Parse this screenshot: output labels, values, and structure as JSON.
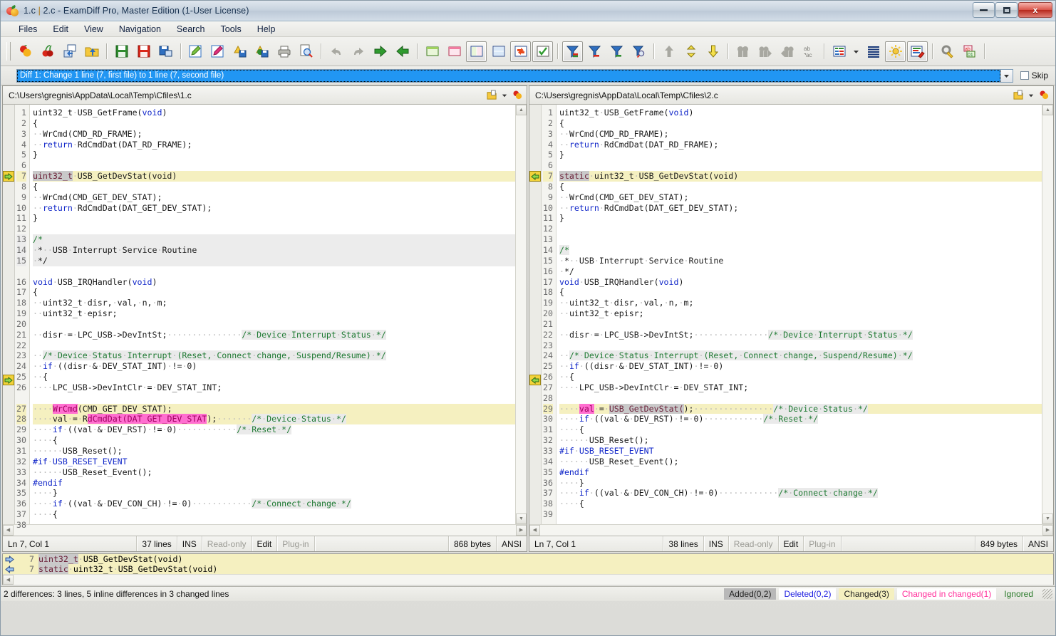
{
  "window": {
    "title": "1.c  |  2.c - ExamDiff Pro, Master Edition (1-User License)",
    "title_left": "1.c",
    "title_sep": "|",
    "title_right": "2.c - ExamDiff Pro, Master Edition (1-User License)",
    "minimize_label": "Minimize",
    "maximize_label": "Maximize",
    "close_label": "x"
  },
  "menubar": [
    {
      "label": "Files"
    },
    {
      "label": "Edit"
    },
    {
      "label": "View"
    },
    {
      "label": "Navigation"
    },
    {
      "label": "Search"
    },
    {
      "label": "Tools"
    },
    {
      "label": "Help"
    }
  ],
  "toolbar": {
    "groups": [
      [
        "compare-files-icon",
        "compare-again-icon",
        "swap-files-icon",
        "open-folder-icon"
      ],
      [
        "save-icon",
        "save-right-icon",
        "save-as-icon"
      ],
      [
        "edit-left-icon",
        "edit-right-icon",
        "save-report-icon",
        "save-html-report-icon",
        "print-icon",
        "print-preview-icon"
      ],
      [
        "undo-icon",
        "redo-icon",
        "copy-right-icon",
        "copy-left-icon"
      ],
      [
        "view-left-only-icon",
        "view-right-only-icon",
        "view-side-by-side-icon",
        "view-over-under-icon",
        "view-combined-icon",
        "view-check-icon"
      ],
      [
        "filter-all-icon",
        "filter-deleted-icon",
        "filter-added-icon",
        "filter-find-icon"
      ],
      [
        "first-diff-icon",
        "next-diff-icon",
        "prev-diff-icon"
      ],
      [
        "find-icon",
        "find-next-icon",
        "find-prev-icon",
        "replace-icon"
      ],
      [
        "bookmark-icon",
        "bookmark-dropdown-icon",
        "line-numbers-icon",
        "highlight-icon",
        "syntax-colors-icon"
      ],
      [
        "options-icon",
        "ignore-options-icon"
      ]
    ]
  },
  "diffbar": {
    "current_diff": "Diff 1: Change 1 line (7, first file) to 1 line (7, second file)",
    "dropdown_icon": "chevron-down-icon",
    "skip_label": "Skip",
    "skip_checked": false
  },
  "left_pane": {
    "path": "C:\\Users\\gregnis\\AppData\\Local\\Temp\\Cfiles\\1.c",
    "status": {
      "position": "Ln 7, Col 1",
      "lines": "37 lines",
      "insert_mode": "INS",
      "readonly": "Read-only",
      "edit": "Edit",
      "plugin": "Plug-in",
      "bytes": "868 bytes",
      "encoding": "ANSI"
    },
    "lines": [
      {
        "n": "1",
        "text": "uint32_t·USB_GetFrame(void)"
      },
      {
        "n": "2",
        "text": "{"
      },
      {
        "n": "3",
        "text": "··WrCmd(CMD_RD_FRAME);"
      },
      {
        "n": "4",
        "text": "··return·RdCmdDat(DAT_RD_FRAME);"
      },
      {
        "n": "5",
        "text": "}"
      },
      {
        "n": "6",
        "text": ""
      },
      {
        "n": "7",
        "text": "uint32_t·USB_GetDevStat(void)"
      },
      {
        "n": "8",
        "text": "{"
      },
      {
        "n": "9",
        "text": "··WrCmd(CMD_GET_DEV_STAT);"
      },
      {
        "n": "10",
        "text": "··return·RdCmdDat(DAT_GET_DEV_STAT);"
      },
      {
        "n": "11",
        "text": "}"
      },
      {
        "n": "12",
        "text": ""
      },
      {
        "n": "13",
        "text": "/*"
      },
      {
        "n": "14",
        "text": "·*··USB·Interrupt·Service·Routine"
      },
      {
        "n": "15",
        "text": "·*/"
      },
      {
        "n": "",
        "text": ""
      },
      {
        "n": "16",
        "text": "void·USB_IRQHandler(void)"
      },
      {
        "n": "17",
        "text": "{"
      },
      {
        "n": "18",
        "text": "··uint32_t·disr,·val,·n,·m;"
      },
      {
        "n": "19",
        "text": "··uint32_t·episr;"
      },
      {
        "n": "20",
        "text": ""
      },
      {
        "n": "21",
        "text": "··disr·=·LPC_USB->DevIntSt;···············/*·Device·Interrupt·Status·*/"
      },
      {
        "n": "22",
        "text": ""
      },
      {
        "n": "23",
        "text": "··/*·Device·Status·Interrupt·(Reset,·Connect·change,·Suspend/Resume)·*/"
      },
      {
        "n": "24",
        "text": "··if·((disr·&·DEV_STAT_INT)·!=·0)"
      },
      {
        "n": "25",
        "text": "··{"
      },
      {
        "n": "26",
        "text": "····LPC_USB->DevIntClr·=·DEV_STAT_INT;"
      },
      {
        "n": "",
        "text": ""
      },
      {
        "n": "27",
        "text": "····WrCmd(CMD_GET_DEV_STAT);"
      },
      {
        "n": "28",
        "text": "····val·=·RdCmdDat(DAT_GET_DEV_STAT);·······/*·Device·Status·*/"
      },
      {
        "n": "29",
        "text": "····if·((val·&·DEV_RST)·!=·0)············/*·Reset·*/"
      },
      {
        "n": "30",
        "text": "····{"
      },
      {
        "n": "31",
        "text": "······USB_Reset();"
      },
      {
        "n": "32",
        "text": "#if·USB_RESET_EVENT"
      },
      {
        "n": "33",
        "text": "······USB_Reset_Event();"
      },
      {
        "n": "34",
        "text": "#endif"
      },
      {
        "n": "35",
        "text": "····}"
      },
      {
        "n": "36",
        "text": "····if·((val·&·DEV_CON_CH)·!=·0)············/*·Connect·change·*/"
      },
      {
        "n": "37",
        "text": "····{"
      },
      {
        "n": "38",
        "text": ""
      }
    ]
  },
  "right_pane": {
    "path": "C:\\Users\\gregnis\\AppData\\Local\\Temp\\Cfiles\\2.c",
    "status": {
      "position": "Ln 7, Col 1",
      "lines": "38 lines",
      "insert_mode": "INS",
      "readonly": "Read-only",
      "edit": "Edit",
      "plugin": "Plug-in",
      "bytes": "849 bytes",
      "encoding": "ANSI"
    },
    "lines": [
      {
        "n": "1",
        "text": "uint32_t·USB_GetFrame(void)"
      },
      {
        "n": "2",
        "text": "{"
      },
      {
        "n": "3",
        "text": "··WrCmd(CMD_RD_FRAME);"
      },
      {
        "n": "4",
        "text": "··return·RdCmdDat(DAT_RD_FRAME);"
      },
      {
        "n": "5",
        "text": "}"
      },
      {
        "n": "6",
        "text": ""
      },
      {
        "n": "7",
        "text": "static·uint32_t·USB_GetDevStat(void)"
      },
      {
        "n": "8",
        "text": "{"
      },
      {
        "n": "9",
        "text": "··WrCmd(CMD_GET_DEV_STAT);"
      },
      {
        "n": "10",
        "text": "··return·RdCmdDat(DAT_GET_DEV_STAT);"
      },
      {
        "n": "11",
        "text": "}"
      },
      {
        "n": "12",
        "text": ""
      },
      {
        "n": "13",
        "text": ""
      },
      {
        "n": "14",
        "text": "/*"
      },
      {
        "n": "15",
        "text": "·*··USB·Interrupt·Service·Routine"
      },
      {
        "n": "16",
        "text": "·*/"
      },
      {
        "n": "17",
        "text": "void·USB_IRQHandler(void)"
      },
      {
        "n": "18",
        "text": "{"
      },
      {
        "n": "19",
        "text": "··uint32_t·disr,·val,·n,·m;"
      },
      {
        "n": "20",
        "text": "··uint32_t·episr;"
      },
      {
        "n": "21",
        "text": ""
      },
      {
        "n": "22",
        "text": "··disr·=·LPC_USB->DevIntSt;···············/*·Device·Interrupt·Status·*/"
      },
      {
        "n": "23",
        "text": ""
      },
      {
        "n": "24",
        "text": "··/*·Device·Status·Interrupt·(Reset,·Connect·change,·Suspend/Resume)·*/"
      },
      {
        "n": "25",
        "text": "··if·((disr·&·DEV_STAT_INT)·!=·0)"
      },
      {
        "n": "26",
        "text": "··{"
      },
      {
        "n": "27",
        "text": "····LPC_USB->DevIntClr·=·DEV_STAT_INT;"
      },
      {
        "n": "28",
        "text": ""
      },
      {
        "n": "29",
        "text": "····val·=·USB_GetDevStat();················/*·Device·Status·*/"
      },
      {
        "n": "30",
        "text": "····if·((val·&·DEV_RST)·!=·0)············/*·Reset·*/"
      },
      {
        "n": "31",
        "text": "····{"
      },
      {
        "n": "32",
        "text": "······USB_Reset();"
      },
      {
        "n": "33",
        "text": "#if·USB_RESET_EVENT"
      },
      {
        "n": "34",
        "text": "······USB_Reset_Event();"
      },
      {
        "n": "35",
        "text": "#endif"
      },
      {
        "n": "36",
        "text": "····}"
      },
      {
        "n": "37",
        "text": "····if·((val·&·DEV_CON_CH)·!=·0)············/*·Connect·change·*/"
      },
      {
        "n": "38",
        "text": "····{"
      },
      {
        "n": "39",
        "text": ""
      }
    ]
  },
  "compare_panel": {
    "rows": [
      {
        "marker": "arrow-right-icon",
        "n": "7",
        "text": "uint32_t·USB_GetDevStat(void)"
      },
      {
        "marker": "arrow-left-icon",
        "n": "7",
        "text": "static·uint32_t·USB_GetDevStat(void)"
      }
    ]
  },
  "statusbar": {
    "message": "2 differences: 3 lines, 5 inline differences in 3 changed lines",
    "legend": [
      {
        "key": "added",
        "label": "Added(0,2)"
      },
      {
        "key": "deleted",
        "label": "Deleted(0,2)"
      },
      {
        "key": "changed",
        "label": "Changed(3)"
      },
      {
        "key": "cic",
        "label": "Changed in changed(1)"
      },
      {
        "key": "ignored",
        "label": "Ignored"
      }
    ]
  },
  "colors": {
    "changed_bg": "#f5f0c0",
    "context_bg": "#ececec",
    "inline_pink": "#ff6fd0",
    "inline_gray": "#c9c9c9",
    "keyword": "#0f25c8",
    "comment": "#1f7a33",
    "selection": "#2196f3",
    "marker_yellow": "#f2d23a"
  }
}
